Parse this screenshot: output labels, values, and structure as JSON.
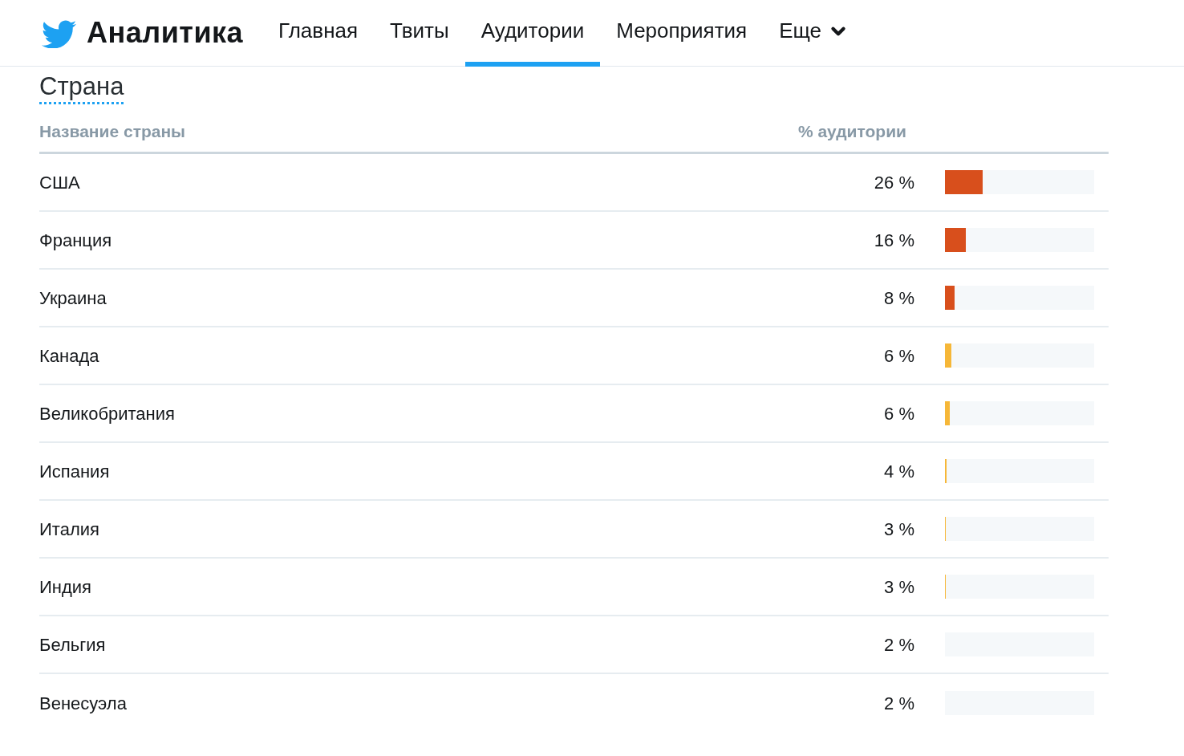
{
  "header": {
    "title": "Аналитика",
    "nav": [
      {
        "label": "Главная",
        "selected": false,
        "kind": "link"
      },
      {
        "label": "Твиты",
        "selected": false,
        "kind": "link"
      },
      {
        "label": "Аудитории",
        "selected": true,
        "kind": "link"
      },
      {
        "label": "Мероприятия",
        "selected": false,
        "kind": "link"
      },
      {
        "label": "Еще",
        "selected": false,
        "kind": "menu"
      }
    ]
  },
  "section": {
    "title": "Страна"
  },
  "table": {
    "columns": [
      "Название страны",
      "% аудитории"
    ],
    "rows": [
      {
        "country": "США",
        "share": "26 %",
        "level": 0.25,
        "color": "#d84f1c"
      },
      {
        "country": "Франция",
        "share": "16 %",
        "level": 0.14,
        "color": "#d84f1c"
      },
      {
        "country": "Украина",
        "share": "8 %",
        "level": 0.065,
        "color": "#d84f1c"
      },
      {
        "country": "Канада",
        "share": "6 %",
        "level": 0.043,
        "color": "#f6b738"
      },
      {
        "country": "Великобритания",
        "share": "6 %",
        "level": 0.032,
        "color": "#f6b738"
      },
      {
        "country": "Испания",
        "share": "4 %",
        "level": 0.011,
        "color": "#f6b738"
      },
      {
        "country": "Италия",
        "share": "3 %",
        "level": 0.006,
        "color": "#f6b738"
      },
      {
        "country": "Индия",
        "share": "3 %",
        "level": 0.006,
        "color": "#f6b738"
      },
      {
        "country": "Бельгия",
        "share": "2 %"
      },
      {
        "country": "Венесуэла",
        "share": "2 %"
      }
    ]
  }
}
